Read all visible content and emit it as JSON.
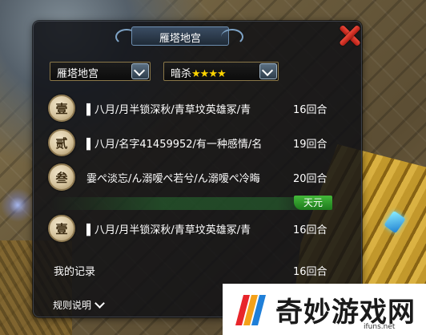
{
  "panel": {
    "title": "雁塔地宫"
  },
  "filters": {
    "dungeon": "雁塔地宫",
    "mode_label": "暗杀",
    "mode_stars": "★★★★",
    "mode_star_count": 4
  },
  "ranking": [
    {
      "rank_glyph": "壹",
      "team": "▌八月/月半锁深秋/青草坟英雄冢/青",
      "turns": "16回合"
    },
    {
      "rank_glyph": "贰",
      "team": "▌八月/名字41459952/有一种感情/名",
      "turns": "19回合"
    },
    {
      "rank_glyph": "叁",
      "team": "霎ぺ淡忘/ん溺嗳ぺ若兮/ん溺嗳ぺ冷晦",
      "turns": "20回合"
    }
  ],
  "server_tag": "天元",
  "server_row": {
    "rank_glyph": "壹",
    "team": "▌八月/月半锁深秋/青草坟英雄冢/青",
    "turns": "16回合"
  },
  "my_record": {
    "label": "我的记录",
    "turns": "16回合"
  },
  "rules_link": "规则说明",
  "watermark": {
    "text": "奇妙游戏网",
    "url": "ifuns.net"
  },
  "colors": {
    "accent_gold": "#8a7748",
    "close_red": "#e03a2c",
    "tag_green": "#2f9a2a",
    "stars": "#ffd400"
  }
}
